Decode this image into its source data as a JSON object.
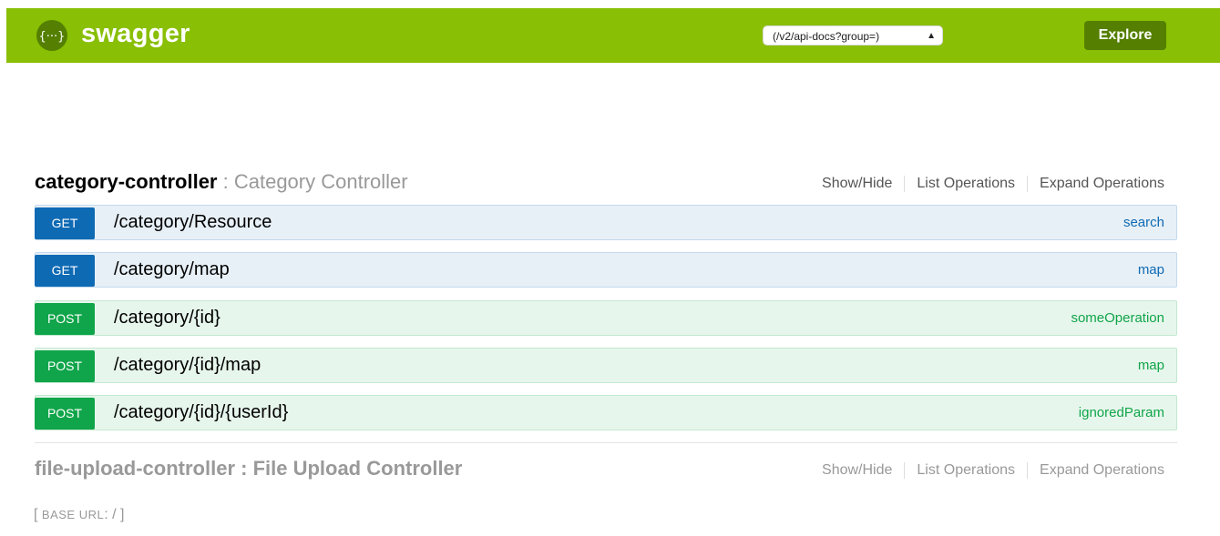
{
  "header": {
    "brand": "swagger",
    "api_select_value": "(/v2/api-docs?group=)",
    "explore_label": "Explore",
    "logo_icon": "swagger-logo-icon",
    "bg_color": "#89bf04"
  },
  "resources": [
    {
      "name": "category-controller",
      "separator": " : ",
      "description": "Category Controller",
      "links": {
        "show_hide": "Show/Hide",
        "list_ops": "List Operations",
        "expand_ops": "Expand Operations"
      },
      "operations": [
        {
          "method": "GET",
          "path": "/category/Resource",
          "summary": "search"
        },
        {
          "method": "GET",
          "path": "/category/map",
          "summary": "map"
        },
        {
          "method": "POST",
          "path": "/category/{id}",
          "summary": "someOperation"
        },
        {
          "method": "POST",
          "path": "/category/{id}/map",
          "summary": "map"
        },
        {
          "method": "POST",
          "path": "/category/{id}/{userId}",
          "summary": "ignoredParam"
        }
      ]
    },
    {
      "name": "file-upload-controller",
      "separator": " : ",
      "description": "File Upload Controller",
      "links": {
        "show_hide": "Show/Hide",
        "list_ops": "List Operations",
        "expand_ops": "Expand Operations"
      }
    }
  ],
  "footer": {
    "open": "[",
    "base_url_label": "BASE URL",
    "colon": ":",
    "base_url_value": "/",
    "close": "]"
  },
  "colors": {
    "get": "#0f6ab4",
    "post": "#10a54a"
  }
}
